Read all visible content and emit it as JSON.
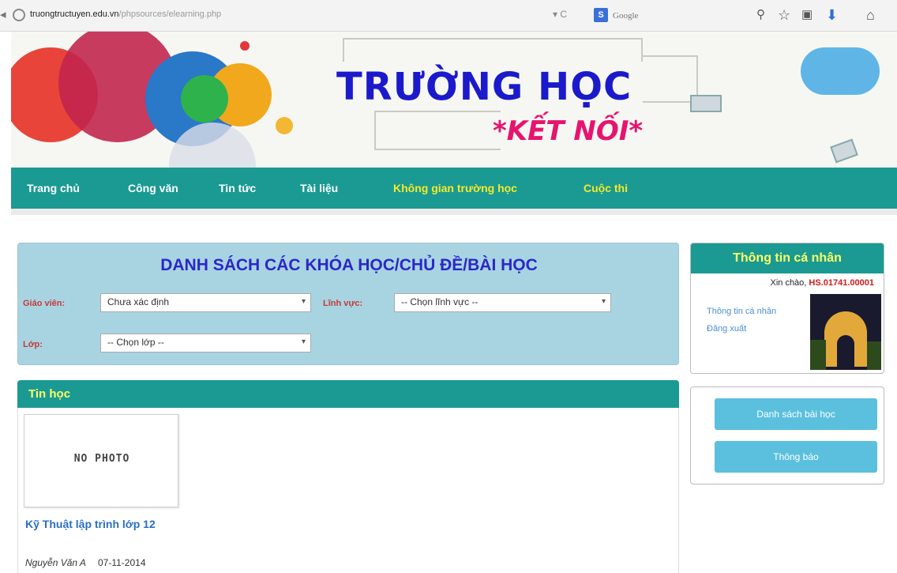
{
  "browser": {
    "url_host": "truongtructuyen.edu.vn",
    "url_path": "/phpsources/elearning.php",
    "search_placeholder": "Google",
    "search_engine_letter": "S"
  },
  "banner": {
    "title": "TRƯỜNG HỌC",
    "subtitle": "*KẾT NỐI*"
  },
  "nav": {
    "items": [
      {
        "label": "Trang chủ",
        "highlight": false
      },
      {
        "label": "Công văn",
        "highlight": false
      },
      {
        "label": "Tin tức",
        "highlight": false
      },
      {
        "label": "Tài liệu",
        "highlight": false
      },
      {
        "label": "Không gian trường học",
        "highlight": true
      },
      {
        "label": "Cuộc thi",
        "highlight": true
      }
    ]
  },
  "courses_panel": {
    "title": "DANH SÁCH CÁC KHÓA HỌC/CHỦ ĐỀ/BÀI HỌC",
    "teacher_label": "Giáo viên:",
    "teacher_value": "Chưa xác định",
    "field_label": "Lĩnh vực:",
    "field_value": "-- Chọn lĩnh vực --",
    "class_label": "Lớp:",
    "class_value": "-- Chọn lớp --"
  },
  "subject": {
    "title": "Tin học",
    "course": {
      "photo_text": "NO PHOTO",
      "title": "Kỹ Thuật lập trình lớp 12",
      "author": "Nguyễn Văn A",
      "date": "07-11-2014"
    }
  },
  "profile": {
    "header": "Thông tin cá nhân",
    "greeting": "Xin chào,",
    "user_id": "HS.01741.00001",
    "link_info": "Thông tin cá nhân",
    "link_logout": "Đăng xuất"
  },
  "menu": {
    "lessons_button": "Danh sách bài học",
    "notice_button": "Thông báo"
  },
  "colors": {
    "nav_bg": "#1a9a93",
    "nav_highlight": "#f4e92a",
    "panel_bg": "#a8d4e2",
    "button_bg": "#5bc0de",
    "title_blue": "#2b27c7"
  }
}
